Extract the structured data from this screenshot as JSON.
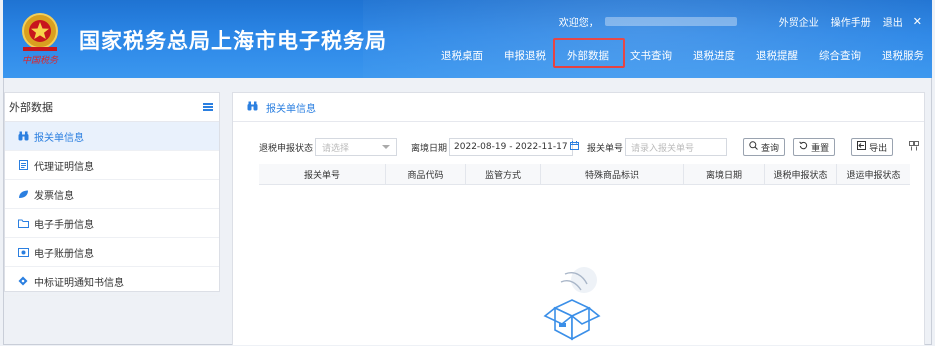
{
  "header": {
    "site_title": "国家税务总局上海市电子税务局",
    "welcome": "欢迎您，",
    "top_links": [
      "外贸企业",
      "操作手册",
      "退出"
    ],
    "close_symbol": "✕",
    "nav": [
      "退税桌面",
      "申报退税",
      "外部数据",
      "文书查询",
      "退税进度",
      "退税提醒",
      "综合查询",
      "退税服务"
    ],
    "active_nav": "外部数据",
    "highlight_color": "#e33030",
    "brand_color": "#2b86e6"
  },
  "sidebar": {
    "title": "外部数据",
    "items": [
      {
        "label": "报关单信息",
        "icon": "binoculars-icon",
        "glyph": "⛭"
      },
      {
        "label": "代理证明信息",
        "icon": "document-icon",
        "glyph": "▤"
      },
      {
        "label": "发票信息",
        "icon": "leaf-icon",
        "glyph": "❧"
      },
      {
        "label": "电子手册信息",
        "icon": "folder-icon",
        "glyph": "▭"
      },
      {
        "label": "电子账册信息",
        "icon": "ledger-icon",
        "glyph": "▣"
      },
      {
        "label": "中标证明通知书信息",
        "icon": "tag-icon",
        "glyph": "◈"
      }
    ]
  },
  "main": {
    "breadcrumb": "报关单信息",
    "filters": {
      "refund_status_label": "退税申报状态",
      "refund_status_placeholder": "请选择",
      "date_label": "离境日期",
      "date_range": "2022-08-19 - 2022-11-17",
      "customs_no_label": "报关单号",
      "customs_no_placeholder": "请录入报关单号",
      "query_label": "查询",
      "reset_label": "重置",
      "export_label": "导出"
    },
    "table": {
      "headers": [
        "报关单号",
        "商品代码",
        "监管方式",
        "特殊商品标识",
        "离境日期",
        "退税申报状态",
        "退运申报状态"
      ],
      "rows": []
    }
  }
}
